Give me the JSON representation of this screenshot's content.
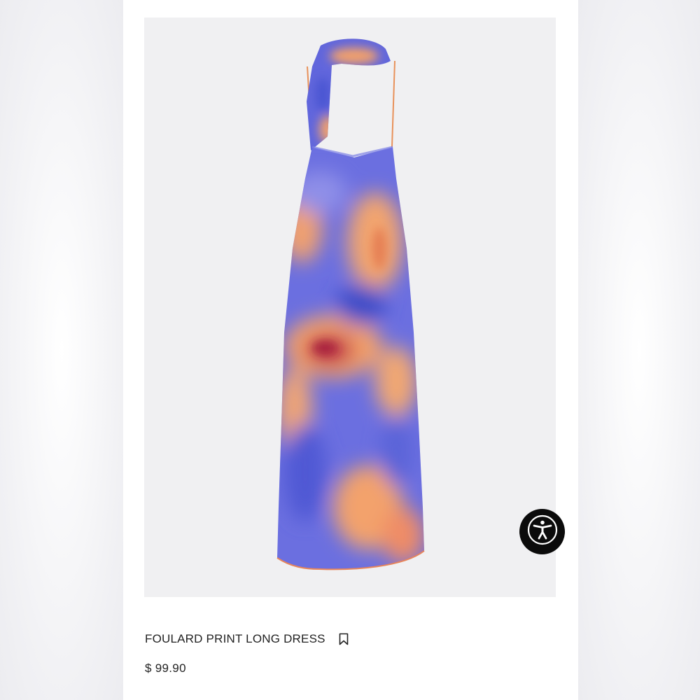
{
  "product": {
    "name": "FOULARD PRINT LONG DRESS",
    "price": "$ 99.90"
  },
  "icons": {
    "bookmark": "bookmark-icon",
    "accessibility": "accessibility-icon"
  },
  "colors": {
    "print_blue": "#5a63d8",
    "print_orange": "#f3a06a",
    "print_red": "#c0324a",
    "photo_background": "#f0f0f2",
    "accessibility_button": "#0b0b0b"
  }
}
